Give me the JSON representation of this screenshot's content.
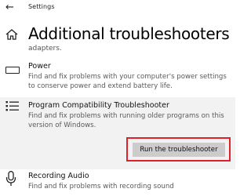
{
  "window": {
    "title": "Settings",
    "back_icon": "back-arrow-icon"
  },
  "page": {
    "title": "Additional troubleshooters",
    "home_icon": "home-icon"
  },
  "partial_text": "adapters.",
  "items": [
    {
      "icon": "battery-icon",
      "title": "Power",
      "description": "Find and fix problems with your computer's power settings to conserve power and extend battery life."
    },
    {
      "icon": "list-icon",
      "title": "Program Compatibility Troubleshooter",
      "description": "Find and fix problems with running older programs on this version of Windows.",
      "action_label": "Run the troubleshooter",
      "expanded": true
    },
    {
      "icon": "microphone-icon",
      "title": "Recording Audio",
      "description": "Find and fix problems with recording sound"
    }
  ],
  "colors": {
    "highlight_border": "#e0202a",
    "selected_item_bg": "#f2f2f2",
    "button_bg": "#cccccc"
  }
}
